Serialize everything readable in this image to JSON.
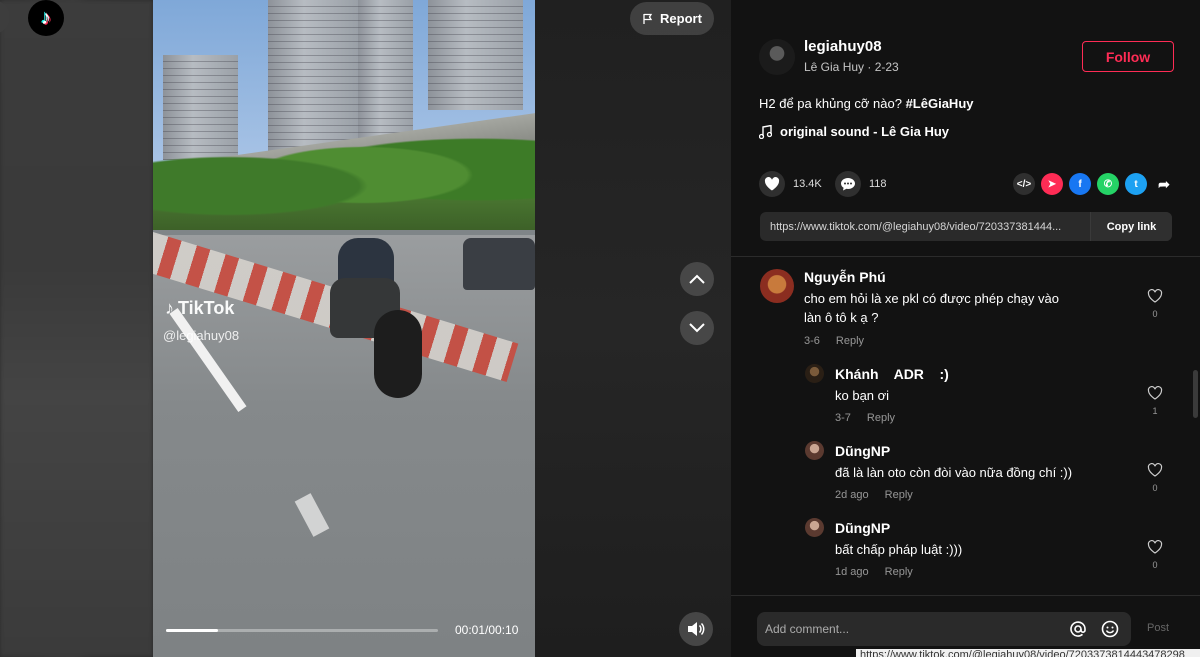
{
  "window": {
    "title": "TikTok"
  },
  "logo": {
    "icon": "tiktok-logo"
  },
  "video": {
    "watermark_brand": "TikTok",
    "watermark_handle": "@legiahuy08",
    "time": "00:01/00:10",
    "progress": 0.19
  },
  "controls": {
    "report_label": "Report",
    "up_icon": "chevron-up-icon",
    "down_icon": "chevron-down-icon",
    "volume_icon": "volume-icon"
  },
  "author": {
    "username": "legiahuy08",
    "subtitle": "Lê Gia Huy · 2-23",
    "follow_label": "Follow"
  },
  "post": {
    "caption_text": "H2 để pa khủng cỡ nào? ",
    "caption_tag": "#LêGiaHuy",
    "music": "original sound - Lê Gia Huy"
  },
  "stats": {
    "likes": "13.4K",
    "comments": "118"
  },
  "share": {
    "icons": [
      "embed-icon",
      "send-icon",
      "facebook-icon",
      "whatsapp-icon",
      "twitter-icon",
      "share-arrow-icon"
    ]
  },
  "link": {
    "url": "https://www.tiktok.com/@legiahuy08/video/720337381444...",
    "copy_label": "Copy link"
  },
  "comments": [
    {
      "name": "Nguyễn Phú",
      "text": "cho em hỏi là xe pkl có được phép chạy vào làn ô tô k ạ ?",
      "time": "3-6",
      "reply": "Reply",
      "likes": "0"
    },
    {
      "name": "Khánh    ADR    :)",
      "text": "ko bạn ơi",
      "time": "3-7",
      "reply": "Reply",
      "likes": "1"
    },
    {
      "name": "DũngNP",
      "text": "đã là làn oto còn đòi vào nữa đồng chí :))",
      "time": "2d ago",
      "reply": "Reply",
      "likes": "0"
    },
    {
      "name": "DũngNP",
      "text": "bất chấp pháp luật :)))",
      "time": "1d ago",
      "reply": "Reply",
      "likes": "0"
    }
  ],
  "composer": {
    "placeholder": "Add comment...",
    "post_label": "Post"
  },
  "status_bar": {
    "url": "https://www.tiktok.com/@legiahuy08/video/7203373814443478298"
  },
  "colors": {
    "accent": "#fe2c55",
    "panel_bg": "#121212"
  }
}
